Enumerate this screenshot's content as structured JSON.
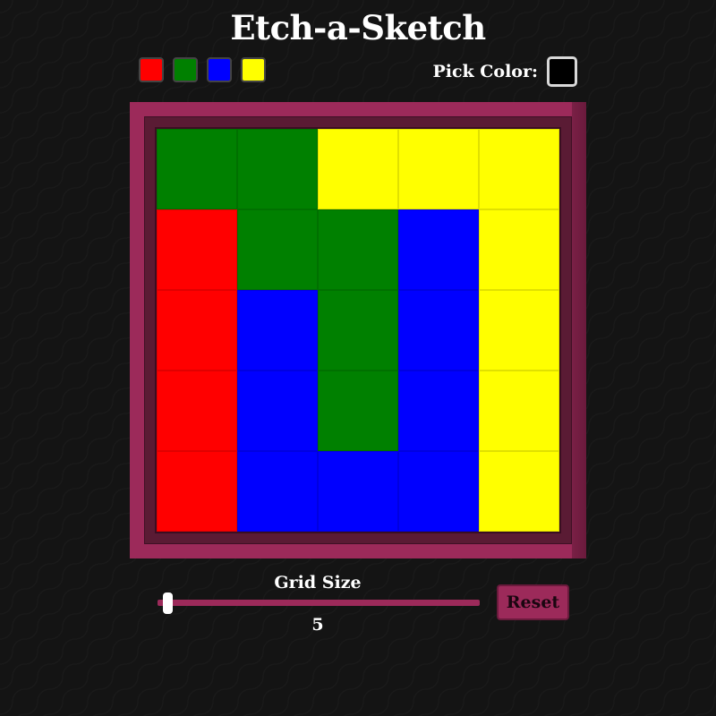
{
  "app": {
    "title": "Etch-a-Sketch"
  },
  "palette": {
    "swatches": [
      {
        "name": "red",
        "color": "#ff0000"
      },
      {
        "name": "green",
        "color": "#008000"
      },
      {
        "name": "blue",
        "color": "#0000ff"
      },
      {
        "name": "yellow",
        "color": "#ffff00"
      }
    ],
    "pick_label": "Pick Color:",
    "current_color": "#000000"
  },
  "board": {
    "frame_color": "#9c2a5a",
    "size": 5,
    "cells": [
      [
        "#008000",
        "#008000",
        "#ffff00",
        "#ffff00",
        "#ffff00"
      ],
      [
        "#ff0000",
        "#008000",
        "#008000",
        "#0000ff",
        "#ffff00"
      ],
      [
        "#ff0000",
        "#0000ff",
        "#008000",
        "#0000ff",
        "#ffff00"
      ],
      [
        "#ff0000",
        "#0000ff",
        "#008000",
        "#0000ff",
        "#ffff00"
      ],
      [
        "#ff0000",
        "#0000ff",
        "#0000ff",
        "#0000ff",
        "#ffff00"
      ]
    ]
  },
  "controls": {
    "grid_size_label": "Grid Size",
    "grid_size_value": "5",
    "slider_min": 5,
    "slider_max": 100,
    "slider_value": 5,
    "reset_label": "Reset"
  }
}
